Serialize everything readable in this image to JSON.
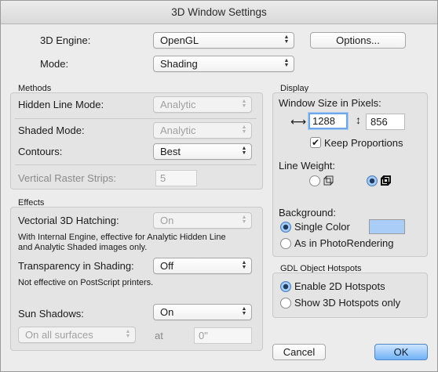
{
  "window": {
    "title": "3D Window Settings"
  },
  "top": {
    "engine_label": "3D Engine:",
    "engine_value": "OpenGL",
    "options_button": "Options...",
    "mode_label": "Mode:",
    "mode_value": "Shading"
  },
  "methods": {
    "title": "Methods",
    "hidden_line_label": "Hidden Line Mode:",
    "hidden_line_value": "Analytic",
    "shaded_mode_label": "Shaded Mode:",
    "shaded_mode_value": "Analytic",
    "contours_label": "Contours:",
    "contours_value": "Best",
    "raster_label": "Vertical Raster Strips:",
    "raster_value": "5"
  },
  "effects": {
    "title": "Effects",
    "hatching_label": "Vectorial 3D Hatching:",
    "hatching_value": "On",
    "hatching_note_line1": "With Internal Engine, effective for Analytic Hidden Line",
    "hatching_note_line2": "and Analytic Shaded images only.",
    "transparency_label": "Transparency in Shading:",
    "transparency_value": "Off",
    "transparency_note": "Not effective on PostScript printers.",
    "sun_label": "Sun Shadows:",
    "sun_value": "On",
    "surfaces_value": "On all surfaces",
    "at_label": "at",
    "at_value": "0\""
  },
  "display": {
    "title": "Display",
    "window_size_label": "Window Size in Pixels:",
    "width_value": "1288",
    "height_value": "856",
    "keep_proportions_label": "Keep Proportions",
    "keep_proportions_checked": true,
    "line_weight_label": "Line Weight:",
    "background_label": "Background:",
    "single_color_label": "Single Color",
    "single_color_swatch": "#a9cdf7",
    "photo_label": "As in PhotoRendering"
  },
  "gdl": {
    "title": "GDL Object Hotspots",
    "enable_2d_label": "Enable 2D Hotspots",
    "show_3d_label": "Show 3D Hotspots only"
  },
  "footer": {
    "cancel": "Cancel",
    "ok": "OK"
  }
}
